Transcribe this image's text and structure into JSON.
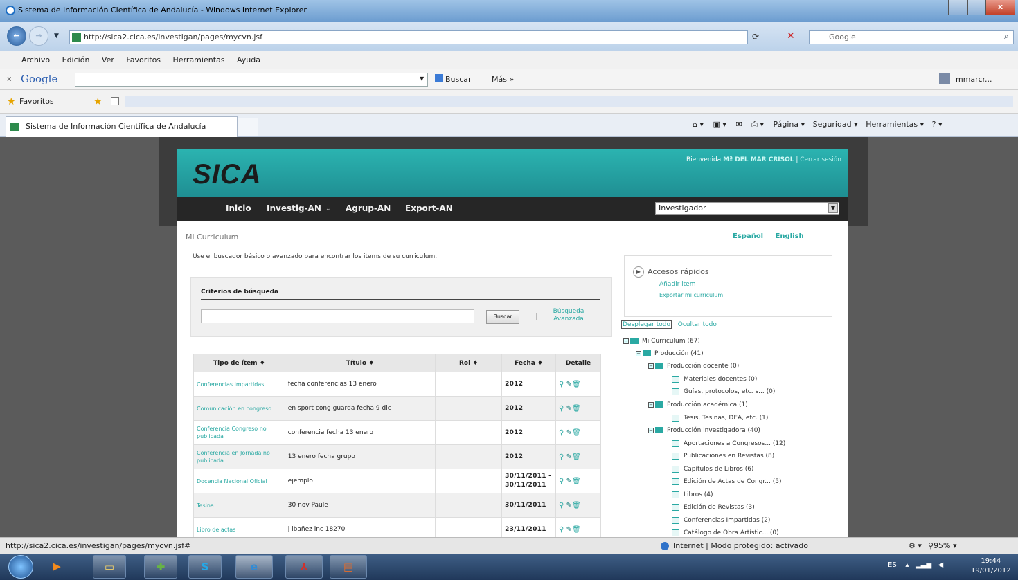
{
  "window": {
    "title": "Sistema de Información Científica de Andalucía - Windows Internet Explorer",
    "close_label": "x"
  },
  "address": {
    "url": "http://sica2.cica.es/investigan/pages/mycvn.jsf",
    "search_placeholder": "Google"
  },
  "menu": [
    "Archivo",
    "Edición",
    "Ver",
    "Favoritos",
    "Herramientas",
    "Ayuda"
  ],
  "google_toolbar": {
    "close": "x",
    "logo": "Google",
    "buscar": "Buscar",
    "mas": "Más »",
    "user": "mmarcr..."
  },
  "favorites": {
    "label": "Favoritos"
  },
  "tab": {
    "title": "Sistema de Información Científica de Andalucía"
  },
  "command_bar": {
    "pagina": "Página",
    "seguridad": "Seguridad",
    "herramientas": "Herramientas"
  },
  "site": {
    "logo": "SICA",
    "welcome_prefix": "Bienvenida",
    "user_name": "Mª DEL MAR CRISOL",
    "logout": "Cerrar sesión",
    "nav": [
      "Inicio",
      "Investig-AN",
      "Agrup-AN",
      "Export-AN"
    ],
    "role": "Investigador",
    "breadcrumb": "Mi Curriculum",
    "lang_es": "Español",
    "lang_en": "English",
    "intro": "Use el buscador básico o avanzado para encontrar los items de su curriculum.",
    "criteria_title": "Criterios de búsqueda",
    "buscar_button": "Buscar",
    "separator": "|",
    "advanced_search": "Búsqueda Avanzada"
  },
  "table": {
    "headers": [
      "Tipo de ítem ♦",
      "Título ♦",
      "Rol ♦",
      "Fecha ♦",
      "Detalle"
    ],
    "rows": [
      {
        "tipo": "Conferencias impartidas",
        "titulo": "fecha conferencias 13 enero",
        "rol": "",
        "fecha": "2012"
      },
      {
        "tipo": "Comunicación en congreso",
        "titulo": "en sport cong guarda fecha 9 dic",
        "rol": "",
        "fecha": "2012"
      },
      {
        "tipo": "Conferencia Congreso no publicada",
        "titulo": "conferencia fecha 13 enero",
        "rol": "",
        "fecha": "2012"
      },
      {
        "tipo": "Conferencia en Jornada no publicada",
        "titulo": "13 enero fecha grupo",
        "rol": "",
        "fecha": "2012"
      },
      {
        "tipo": "Docencia Nacional Oficial",
        "titulo": "ejemplo",
        "rol": "",
        "fecha": "30/11/2011 - 30/11/2011"
      },
      {
        "tipo": "Tesina",
        "titulo": "30 nov Paule",
        "rol": "",
        "fecha": "30/11/2011"
      },
      {
        "tipo": "Libro de actas",
        "titulo": "j ibañez inc 18270",
        "rol": "",
        "fecha": "23/11/2011"
      }
    ]
  },
  "quick_access": {
    "title": "Accesos rápidos",
    "add_item": "Añadir item",
    "export": "Exportar mi curriculum"
  },
  "tree": {
    "expand_all": "Desplegar todo",
    "divider": "|",
    "collapse_all": "Ocultar todo",
    "items": [
      "Mi Curriculum (67)",
      "Producción (41)",
      "Producción docente (0)",
      "Materiales docentes (0)",
      "Guías, protocolos, etc. s... (0)",
      "Producción académica (1)",
      "Tesis, Tesinas, DEA, etc. (1)",
      "Producción investigadora (40)",
      "Aportaciones a Congresos... (12)",
      "Publicaciones en Revistas (8)",
      "Capítulos de Libros (6)",
      "Edición de Actas de Congr... (5)",
      "Libros (4)",
      "Edición de Revistas (3)",
      "Conferencias Impartidas (2)",
      "Catálogo de Obra Artístic... (0)"
    ]
  },
  "status": {
    "url": "http://sica2.cica.es/investigan/pages/mycvn.jsf#",
    "zone": "Internet | Modo protegido: activado",
    "zoom": "95%"
  },
  "taskbar": {
    "lang": "ES",
    "time": "19:44",
    "date": "19/01/2012"
  }
}
